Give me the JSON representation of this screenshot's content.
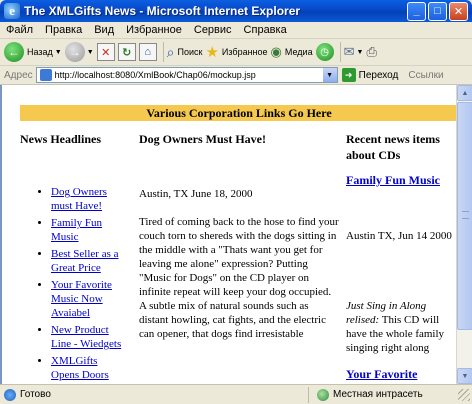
{
  "window": {
    "title": "The XMLGifts News - Microsoft Internet Explorer",
    "app_letter": "e",
    "minimize": "_",
    "maximize": "□",
    "close": "✕"
  },
  "menu": [
    "Файл",
    "Правка",
    "Вид",
    "Избранное",
    "Сервис",
    "Справка"
  ],
  "toolbar": {
    "back": "Назад",
    "search": "Поиск",
    "favorites": "Избранное",
    "media": "Медиа"
  },
  "address": {
    "label": "Адрес",
    "url": "http://localhost:8080/XmlBook/Chap06/mockup.jsp",
    "go": "Переход",
    "links": "Ссылки"
  },
  "page": {
    "banner": "Various Corporation Links Go Here",
    "col1_heading": "News Headlines",
    "col2_heading": "Dog Owners Must Have!",
    "col3_heading": "Recent news items about CDs",
    "headlines": [
      "Dog Owners must Have!",
      "Family Fun Music",
      "Best Seller as a Great Price",
      "Your Favorite Music Now Avaiabel",
      "New Product Line - Wiedgets",
      "XMLGifts Opens Doors"
    ],
    "mid_dateline": "Austin, TX June 18, 2000",
    "mid_para1": "Tired of coming back to the hose to find your couch torn to shereds with the dogs sitting in the middle with a \"Thats want you get for leaving me alone\" expression? Putting \"Music for Dogs\" on the CD player on infinite repeat will keep your dog occupied.",
    "mid_para2": "A subtle mix of natural sounds such as distant howling, cat fights, and the electric can opener, that dogs find irresistable",
    "right_link1": "Family Fun Music",
    "right_dateline": "Austin TX, Jun 14 2000",
    "right_italic": "Just Sing in Along relised:",
    "right_text": " This CD will have the whole family singing right along",
    "right_link2": "Your Favorite"
  },
  "status": {
    "text": "Готово",
    "zone": "Местная интрасеть"
  }
}
